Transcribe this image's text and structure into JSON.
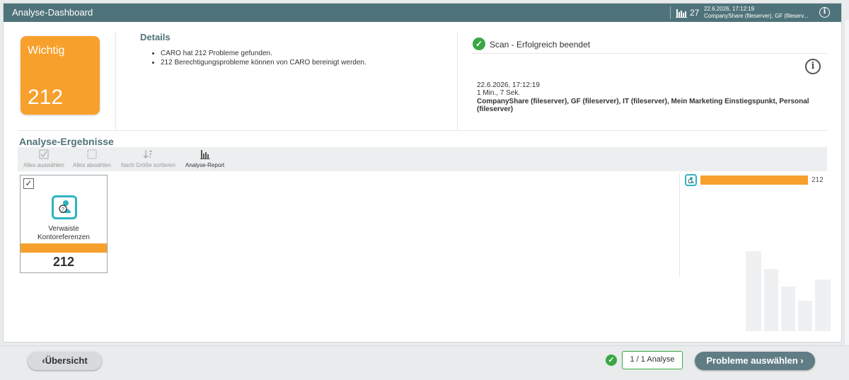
{
  "titlebar": {
    "title": "Analyse-Dashboard",
    "problem_count": "27",
    "scan_date": "22.6.2026, 17:12:19",
    "scan_targets_short": "CompanyShare (fileserver), GF (fileserv..."
  },
  "severity": {
    "label": "Wichtig",
    "value": "212",
    "color": "#f7a02c"
  },
  "details": {
    "title": "Details",
    "items": [
      "CARO hat 212 Probleme gefunden.",
      "212 Berechtigungsprobleme können von CARO bereinigt werden."
    ]
  },
  "scan": {
    "status": "Scan - Erfolgreich beendet",
    "date": "22.6.2026, 17:12:19",
    "duration": "1 Min., 7 Sek.",
    "targets": "CompanyShare (fileserver), GF (fileserver), IT (fileserver), Mein Marketing Einstiegspunkt, Personal (fileserver)"
  },
  "results": {
    "title": "Analyse-Ergebnisse",
    "toolbar": {
      "select_all": "Alles auswählen",
      "deselect_all": "Alles abwählen",
      "sort_by_size": "Nach Größe sortieren",
      "report": "Analyse-Report"
    },
    "cards": [
      {
        "label_line1": "Verwaiste",
        "label_line2": "Kontoreferenzen",
        "value": "212",
        "checked": true
      }
    ],
    "legend": {
      "value": "212",
      "fraction": 1.0
    }
  },
  "footer": {
    "overview": "Übersicht",
    "analysis_counter": "1 / 1 Analyse",
    "select_problems": "Probleme auswählen"
  },
  "colors": {
    "header": "#4f737a",
    "accent_orange": "#f7a02c",
    "accent_teal": "#2eb4c0",
    "success_green": "#3aa744"
  }
}
